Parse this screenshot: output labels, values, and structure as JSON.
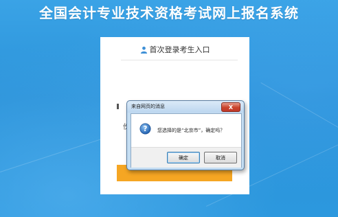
{
  "site": {
    "title": "全国会计专业技术资格考试网上报名系统"
  },
  "login_card": {
    "title": "首次登录考生入口",
    "partial_label": "份",
    "icon": "user-icon"
  },
  "dialog": {
    "title": "来自网页的消息",
    "message": "您选择的是“北京市”，确定吗？",
    "icon": "question-icon",
    "ok_label": "确定",
    "cancel_label": "取消",
    "close_label": "X"
  },
  "colors": {
    "background": "#2f9be0",
    "login_button": "#f5a623",
    "dialog_frame": "#c4ddf2",
    "close_button": "#c9442c"
  }
}
